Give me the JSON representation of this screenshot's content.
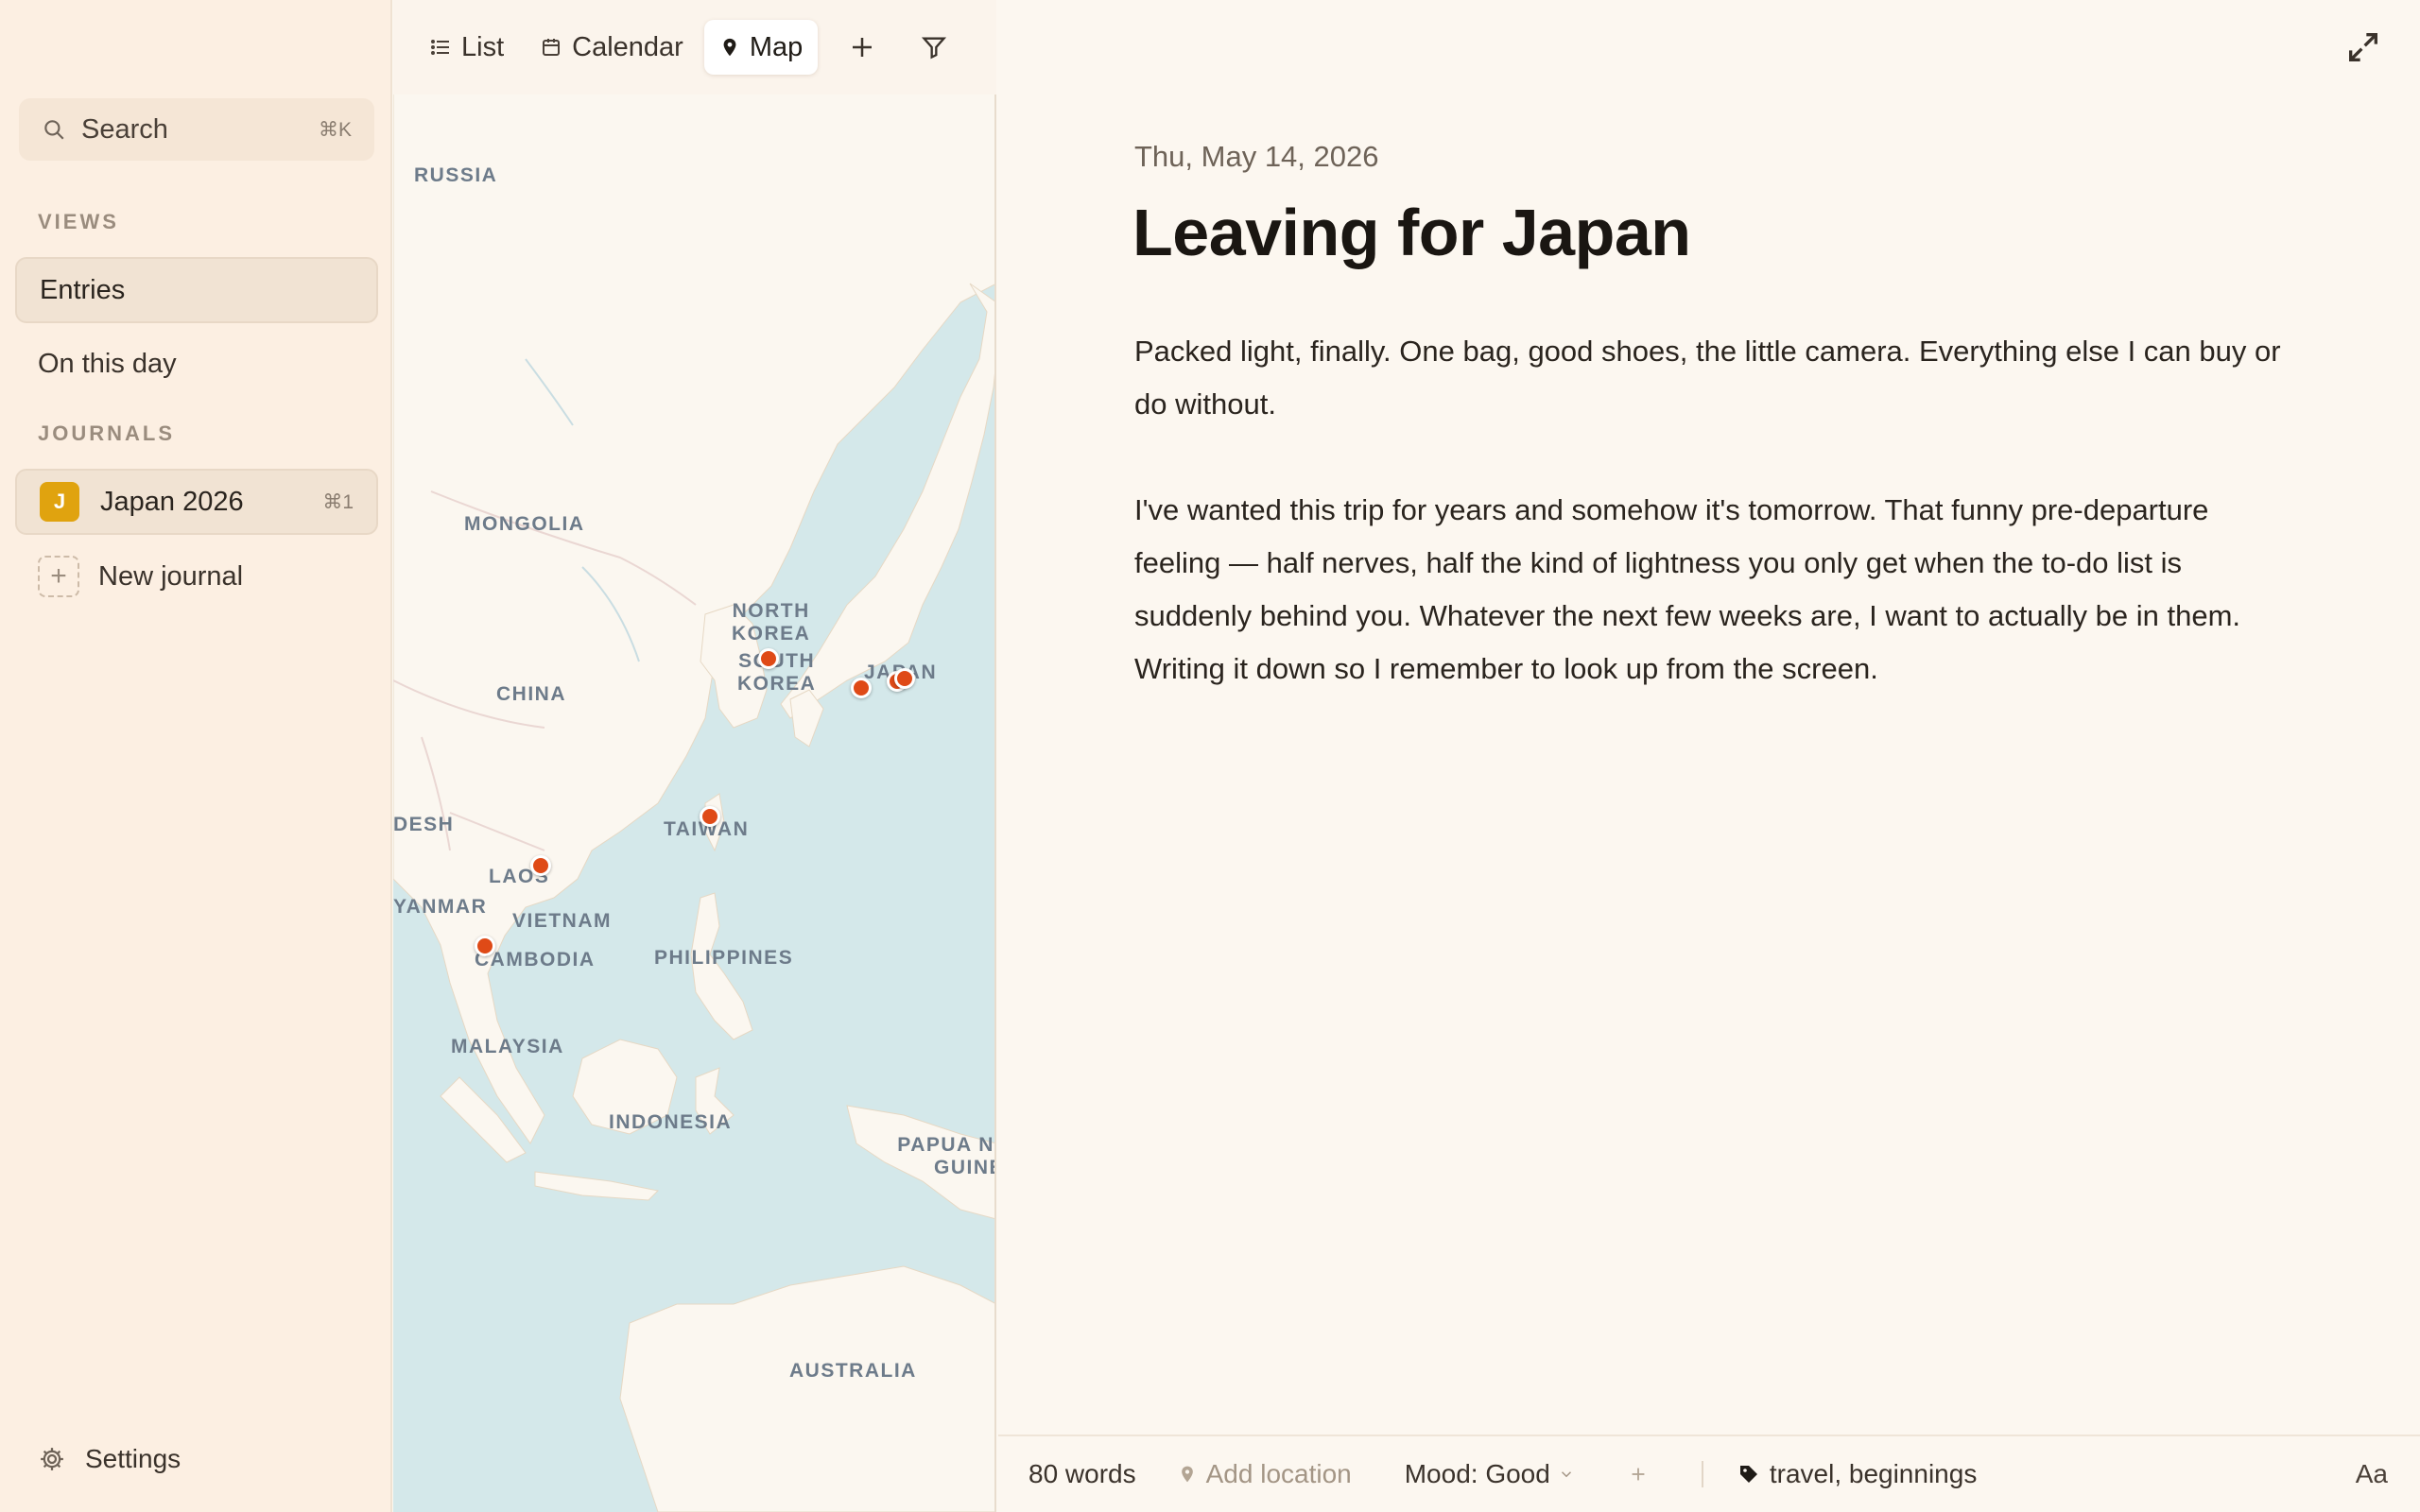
{
  "sidebar": {
    "search": {
      "label": "Search",
      "shortcut": "⌘K"
    },
    "views_heading": "VIEWS",
    "views": [
      {
        "label": "Entries",
        "active": true
      },
      {
        "label": "On this day",
        "active": false
      }
    ],
    "journals_heading": "JOURNALS",
    "journals": [
      {
        "initial": "J",
        "name": "Japan 2026",
        "shortcut": "⌘1",
        "color": "#e0a30f"
      }
    ],
    "new_journal_label": "New journal",
    "settings_label": "Settings"
  },
  "toolbar": {
    "tabs": [
      {
        "label": "List",
        "icon": "list-icon",
        "active": false
      },
      {
        "label": "Calendar",
        "icon": "calendar-icon",
        "active": false
      },
      {
        "label": "Map",
        "icon": "map-pin-icon",
        "active": true
      }
    ],
    "add_icon": "plus-icon",
    "filter_icon": "filter-icon"
  },
  "map": {
    "labels": {
      "russia": "RUSSIA",
      "mongolia": "MONGOLIA",
      "china": "CHINA",
      "north_korea_1": "NORTH",
      "north_korea_2": "KOREA",
      "south_korea_1": "SOUTH",
      "south_korea_2": "KOREA",
      "japan": "JAPAN",
      "taiwan": "TAIWAN",
      "desh": "DESH",
      "laos": "LAOS",
      "myanmar": "YANMAR",
      "vietnam": "VIETNAM",
      "cambodia": "CAMBODIA",
      "philippines": "PHILIPPINES",
      "malaysia": "MALAYSIA",
      "indonesia": "INDONESIA",
      "png_1": "PAPUA NE",
      "png_2": "GUINEA",
      "australia": "AUSTRALIA"
    },
    "pin_color": "#df4a17"
  },
  "entry": {
    "date": "Thu, May 14, 2026",
    "title": "Leaving for Japan",
    "paragraphs": [
      "Packed light, finally. One bag, good shoes, the little camera. Everything else I can buy or do without.",
      "I've wanted this trip for years and somehow it's tomorrow. That funny pre-departure feeling — half nerves, half the kind of lightness you only get when the to-do list is suddenly behind you. Whatever the next few weeks are, I want to actually be in them. Writing it down so I remember to look up from the screen."
    ],
    "footer": {
      "word_count": "80 words",
      "add_location": "Add location",
      "mood": "Mood: Good",
      "tags": "travel, beginnings",
      "font_toggle": "Aa"
    }
  }
}
